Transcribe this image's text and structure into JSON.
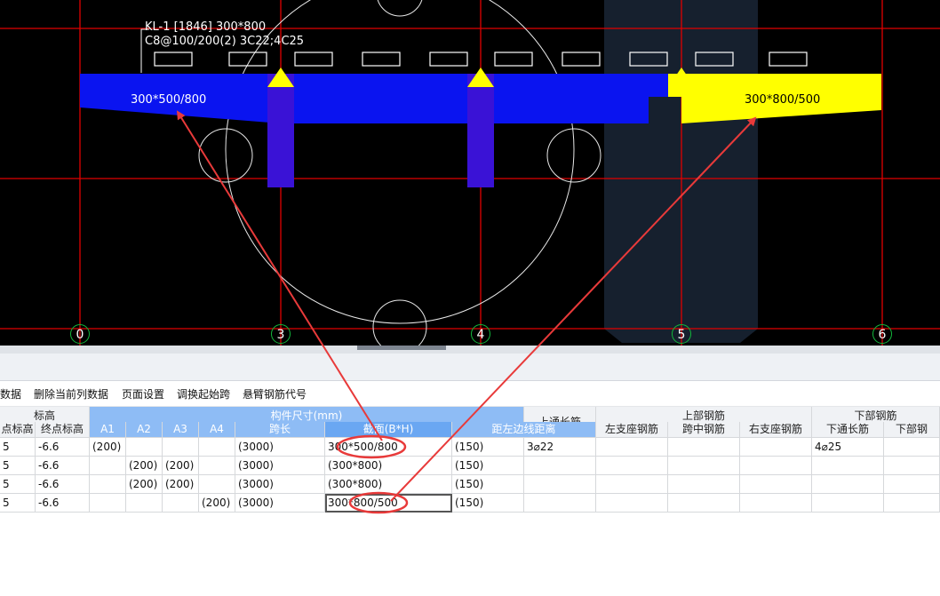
{
  "canvas": {
    "beam_label_line1": "KL-1 [1846] 300*800",
    "beam_label_line2": "C8@100/200(2) 3C22;4C25",
    "segment_left_label": "300*500/800",
    "segment_right_label": "300*800/500",
    "axes": [
      "0",
      "3",
      "4",
      "5",
      "6"
    ],
    "colors": {
      "background": "#000000",
      "grid": "#e00000",
      "beam": "#0a14f0",
      "column": "#3a12d6",
      "highlight": "#ffff00",
      "axis_circle": "#12b83c",
      "annotation": "#e83a3a"
    }
  },
  "toolbar": {
    "items": [
      "数据",
      "删除当前列数据",
      "页面设置",
      "调换起始跨",
      "悬臂钢筋代号"
    ]
  },
  "table": {
    "group_headers": {
      "elevation": "标高",
      "dimensions": "构件尺寸(mm)",
      "top_through": "上通长筋",
      "top_rebar": "上部钢筋",
      "bottom_rebar": "下部钢筋"
    },
    "columns": [
      "点标高",
      "终点标高",
      "A1",
      "A2",
      "A3",
      "A4",
      "跨长",
      "截面(B*H)",
      "距左边线距离",
      "左支座钢筋",
      "跨中钢筋",
      "右支座钢筋",
      "下通长筋",
      "下部钢"
    ],
    "rows": [
      [
        "5",
        "-6.6",
        "(200)",
        "",
        "",
        "",
        "(3000)",
        "300*500/800",
        "(150)",
        "3⌀22",
        "",
        "",
        "",
        "4⌀25",
        ""
      ],
      [
        "5",
        "-6.6",
        "",
        "(200)",
        "(200)",
        "",
        "(3000)",
        "(300*800)",
        "(150)",
        "",
        "",
        "",
        "",
        "",
        ""
      ],
      [
        "5",
        "-6.6",
        "",
        "(200)",
        "(200)",
        "",
        "(3000)",
        "(300*800)",
        "(150)",
        "",
        "",
        "",
        "",
        "",
        ""
      ],
      [
        "5",
        "-6.6",
        "",
        "",
        "",
        "(200)",
        "(3000)",
        "300*800/500",
        "(150)",
        "",
        "",
        "",
        "",
        "",
        ""
      ]
    ]
  }
}
